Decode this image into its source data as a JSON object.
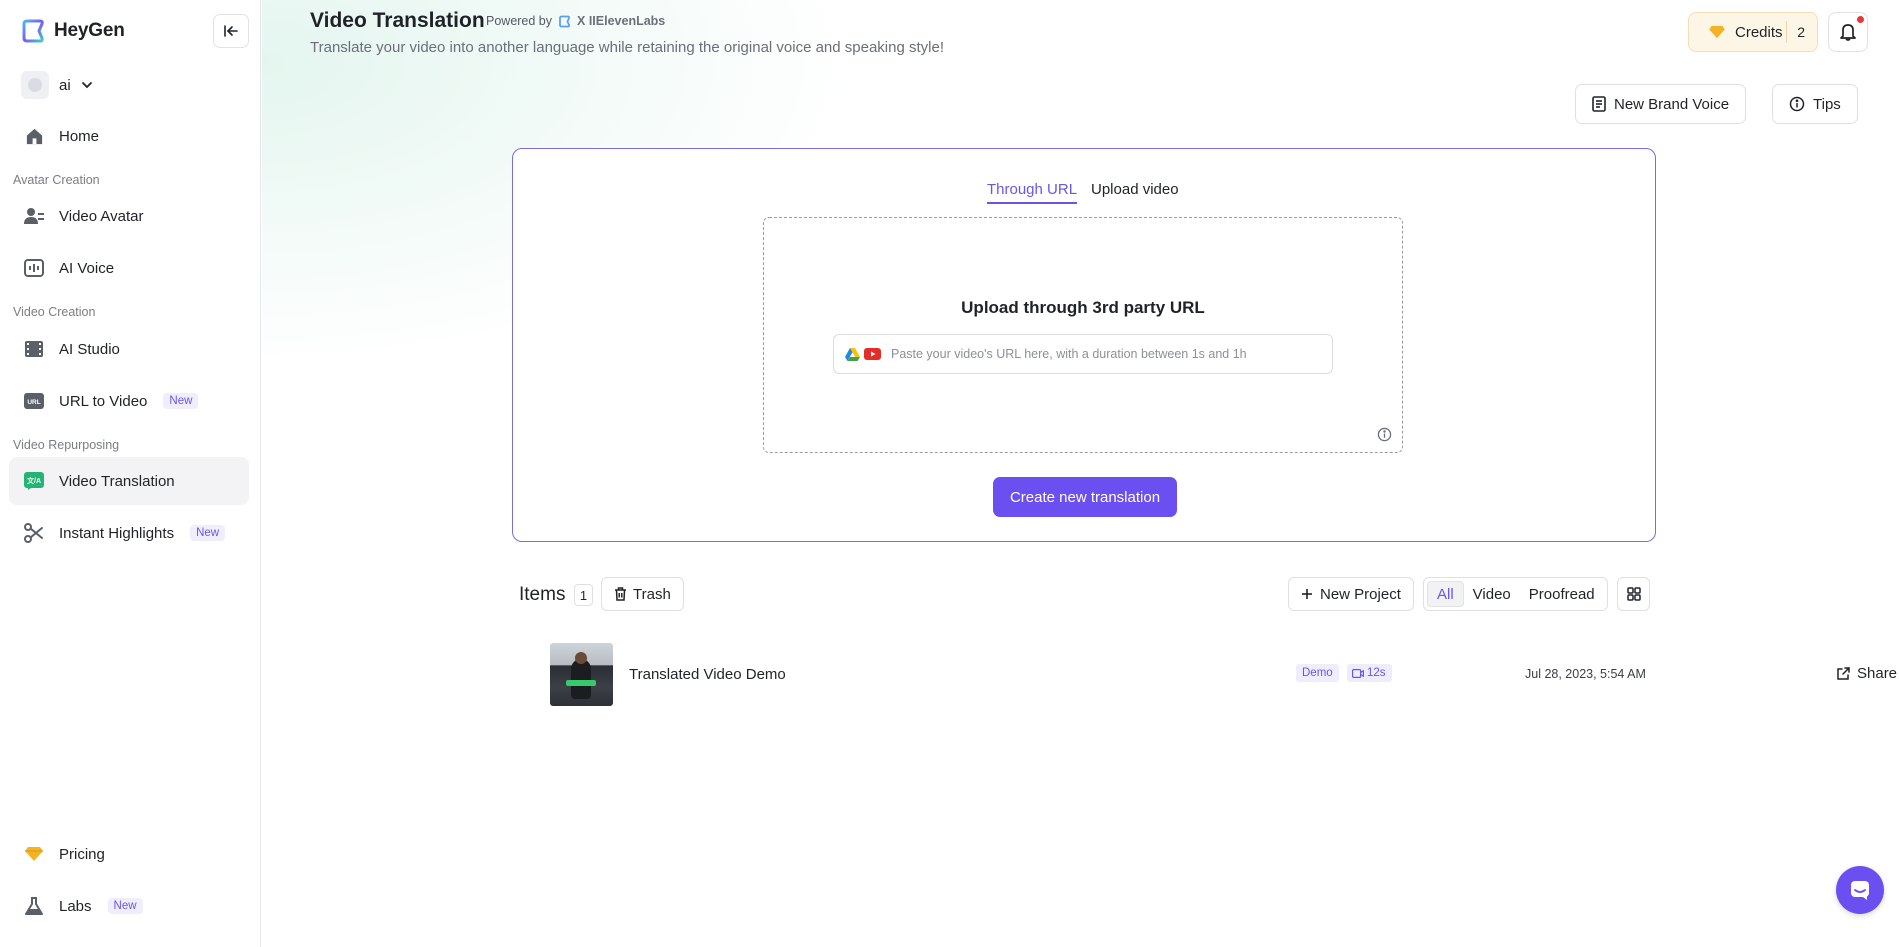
{
  "brand": {
    "name": "HeyGen"
  },
  "workspace": {
    "name": "ai"
  },
  "sidebar": {
    "home": "Home",
    "sections": {
      "avatar_creation": "Avatar Creation",
      "video_creation": "Video Creation",
      "video_repurposing": "Video Repurposing"
    },
    "items": {
      "video_avatar": "Video Avatar",
      "ai_voice": "AI Voice",
      "ai_studio": "AI Studio",
      "url_to_video": "URL to Video",
      "video_translation": "Video Translation",
      "instant_highlights": "Instant Highlights",
      "pricing": "Pricing",
      "labs": "Labs"
    },
    "new_badge": "New",
    "active_item": "video_translation"
  },
  "header": {
    "title": "Video Translation",
    "powered_by": "Powered by",
    "partner": "X IIElevenLabs",
    "subtitle": "Translate your video into another language while retaining the original voice and speaking style!",
    "credits_label": "Credits",
    "credits_count": "2"
  },
  "actions": {
    "new_brand_voice": "New Brand Voice",
    "tips": "Tips"
  },
  "upload": {
    "tabs": [
      "Through URL",
      "Upload video"
    ],
    "active_tab": 0,
    "title": "Upload through 3rd party URL",
    "url_value": "",
    "url_placeholder": "Paste your video's URL here, with a duration between 1s and 1h",
    "create_button": "Create new translation"
  },
  "items": {
    "label": "Items",
    "count": "1",
    "trash": "Trash",
    "new_project": "New Project",
    "filters": [
      "All",
      "Video",
      "Proofread"
    ],
    "active_filter": "All",
    "rows": [
      {
        "title": "Translated Video Demo",
        "badge": "Demo",
        "duration": "12s",
        "date": "Jul 28, 2023, 5:54 AM",
        "share": "Share"
      }
    ]
  },
  "colors": {
    "accent": "#6b4ff0",
    "accent_text": "#6a56e4",
    "credits_bg": "#fdf6e6",
    "notification_dot": "#e5383b"
  },
  "icons": {
    "logo": "heygen-logo-icon",
    "collapse": "collapse-sidebar-icon",
    "home": "home-icon",
    "video_avatar": "user-video-icon",
    "ai_voice": "voice-wave-icon",
    "ai_studio": "film-icon",
    "url_to_video": "url-icon",
    "video_translation": "translate-icon",
    "instant_highlights": "scissors-icon",
    "pricing": "diamond-icon",
    "labs": "flask-icon",
    "credits": "diamond-icon",
    "bell": "bell-icon",
    "brand_voice": "document-icon",
    "tips": "info-icon",
    "google_drive": "google-drive-icon",
    "youtube": "youtube-icon",
    "trash": "trash-icon",
    "plus": "plus-icon",
    "grid": "grid-icon",
    "share": "share-icon",
    "chat": "chat-icon"
  }
}
